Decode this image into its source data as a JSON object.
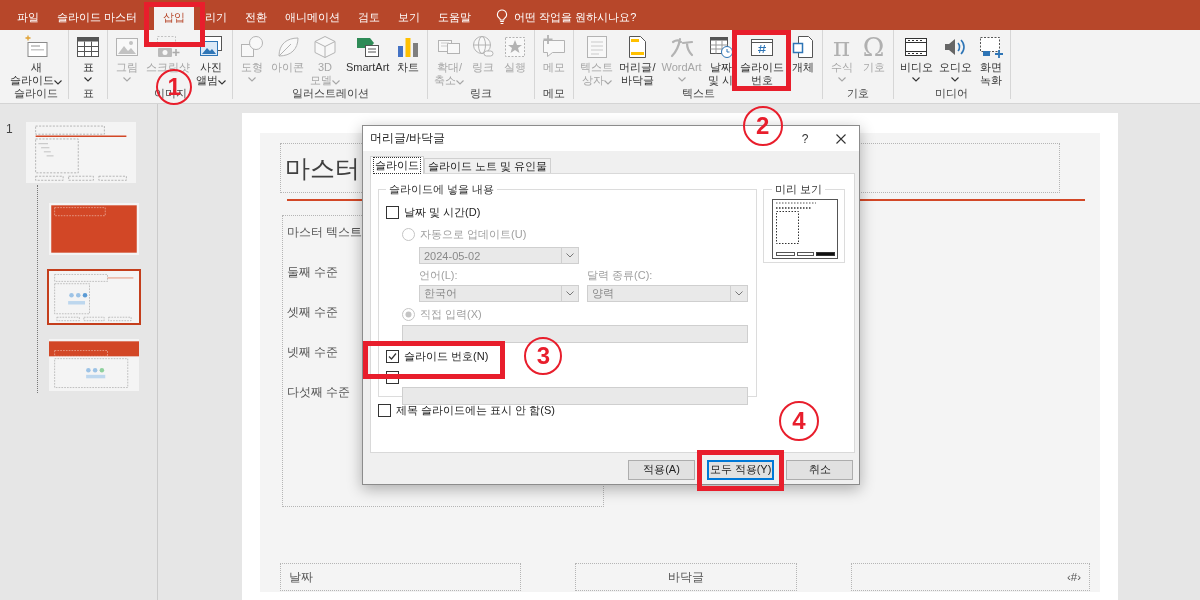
{
  "tabs": [
    {
      "label": "파일",
      "selected": false
    },
    {
      "label": "슬라이드 마스터",
      "selected": false
    },
    {
      "label": "삽입",
      "selected": true,
      "callout": "1"
    },
    {
      "label": "리기",
      "selected": false
    },
    {
      "label": "전환",
      "selected": false
    },
    {
      "label": "애니메이션",
      "selected": false
    },
    {
      "label": "검토",
      "selected": false
    },
    {
      "label": "보기",
      "selected": false
    },
    {
      "label": "도움말",
      "selected": false
    }
  ],
  "tell_me": {
    "placeholder": "어떤 작업을 원하시나요?"
  },
  "ribbon": {
    "groups": [
      {
        "label": "슬라이드",
        "buttons": [
          {
            "kind": "newslide",
            "lines": [
              "새",
              "슬라이드"
            ],
            "dropdown": true,
            "disabled": false
          }
        ]
      },
      {
        "label": "표",
        "buttons": [
          {
            "kind": "table",
            "lines": [
              "표"
            ],
            "dropdown": true,
            "disabled": false
          }
        ]
      },
      {
        "label": "이미지",
        "buttons": [
          {
            "kind": "picture",
            "lines": [
              "그림"
            ],
            "dropdown": true,
            "disabled": true
          },
          {
            "kind": "screenshot",
            "lines": [
              "스크린샷"
            ],
            "dropdown": false,
            "disabled": true
          },
          {
            "kind": "album",
            "lines": [
              "사진",
              "앨범"
            ],
            "dropdown": true,
            "disabled": false
          }
        ]
      },
      {
        "label": "일러스트레이션",
        "buttons": [
          {
            "kind": "shapes",
            "lines": [
              "도형"
            ],
            "dropdown": true,
            "disabled": true
          },
          {
            "kind": "icons",
            "lines": [
              "아이콘"
            ],
            "dropdown": false,
            "disabled": true
          },
          {
            "kind": "model",
            "lines": [
              "3D",
              "모델"
            ],
            "dropdown": true,
            "disabled": true
          },
          {
            "kind": "smartart",
            "lines": [
              "SmartArt"
            ],
            "dropdown": false,
            "disabled": false
          },
          {
            "kind": "chart",
            "lines": [
              "차트"
            ],
            "dropdown": false,
            "disabled": false
          }
        ]
      },
      {
        "label": "링크",
        "buttons": [
          {
            "kind": "zoom",
            "lines": [
              "확대/",
              "축소"
            ],
            "dropdown": true,
            "disabled": true
          },
          {
            "kind": "link",
            "lines": [
              "링크"
            ],
            "dropdown": false,
            "disabled": true
          },
          {
            "kind": "action",
            "lines": [
              "실행"
            ],
            "dropdown": false,
            "disabled": true
          }
        ]
      },
      {
        "label": "메모",
        "buttons": [
          {
            "kind": "comment",
            "lines": [
              "메모"
            ],
            "dropdown": false,
            "disabled": true
          }
        ]
      },
      {
        "label": "텍스트",
        "buttons": [
          {
            "kind": "textbox",
            "lines": [
              "텍스트",
              "상자"
            ],
            "dropdown": true,
            "disabled": true
          },
          {
            "kind": "headerfooter",
            "lines": [
              "머리글/",
              "바닥글"
            ],
            "dropdown": false,
            "disabled": false
          },
          {
            "kind": "wordart",
            "lines": [
              "WordArt"
            ],
            "dropdown": true,
            "disabled": true
          },
          {
            "kind": "datetime",
            "lines": [
              "날짜",
              "및 시"
            ],
            "dropdown": false,
            "disabled": false
          },
          {
            "kind": "slidenumber",
            "lines": [
              "슬라이드",
              "번호"
            ],
            "dropdown": false,
            "disabled": false,
            "callout": "2"
          },
          {
            "kind": "object",
            "lines": [
              "개체"
            ],
            "dropdown": false,
            "disabled": false
          }
        ]
      },
      {
        "label": "기호",
        "buttons": [
          {
            "kind": "equation",
            "glyph": "π",
            "lines": [
              "수식"
            ],
            "dropdown": true,
            "disabled": true
          },
          {
            "kind": "symbol",
            "glyph": "Ω",
            "lines": [
              "기호"
            ],
            "dropdown": false,
            "disabled": true
          }
        ]
      },
      {
        "label": "미디어",
        "buttons": [
          {
            "kind": "video",
            "lines": [
              "비디오"
            ],
            "dropdown": true,
            "disabled": false
          },
          {
            "kind": "audio",
            "lines": [
              "오디오"
            ],
            "dropdown": true,
            "disabled": false
          },
          {
            "kind": "recording",
            "lines": [
              "화면",
              "녹화"
            ],
            "dropdown": false,
            "disabled": false
          }
        ]
      }
    ]
  },
  "slide_panel": {
    "number": "1",
    "thumbnails": [
      {
        "kind": "master",
        "selected": false
      },
      {
        "kind": "title",
        "selected": false
      },
      {
        "kind": "content",
        "selected": true
      },
      {
        "kind": "section",
        "selected": false
      }
    ]
  },
  "slide": {
    "title": "마스터",
    "levels": [
      "마스터 텍스트",
      "둘째 수준",
      "셋째 수준",
      "넷째 수준",
      "다섯째 수준"
    ],
    "placeholders": [
      {
        "kind": "date",
        "text": "날짜"
      },
      {
        "kind": "footer",
        "text": "바닥글"
      },
      {
        "kind": "number",
        "text": "‹#›"
      }
    ]
  },
  "dialog": {
    "title": "머리글/바닥글",
    "help": "?",
    "tabs": [
      {
        "label": "슬라이드",
        "selected": true
      },
      {
        "label": "슬라이드 노트 및 유인물",
        "selected": false
      }
    ],
    "group": {
      "legend": "슬라이드에 넣을 내용",
      "date_time": {
        "label": "날짜 및 시간(D)",
        "checked": false
      },
      "auto_update": {
        "label": "자동으로 업데이트(U)",
        "selected": false,
        "disabled": true
      },
      "date_format": {
        "value": "2024-05-02",
        "disabled": true
      },
      "language": {
        "label": "언어(L):",
        "value": "한국어",
        "disabled": true
      },
      "calendar": {
        "label": "달력 종류(C):",
        "value": "양력",
        "disabled": true
      },
      "fixed": {
        "label": "직접 입력(X)",
        "selected": true,
        "disabled": true
      },
      "fixed_input": {
        "disabled": true
      },
      "slide_number": {
        "label": "슬라이드 번호(N)",
        "checked": true,
        "callout": "3"
      },
      "footer": {
        "checked": false
      },
      "footer_input": {
        "disabled": true
      }
    },
    "hide_on_title": {
      "label": "제목 슬라이드에는 표시 안 함(S)",
      "checked": false
    },
    "preview": {
      "legend": "미리 보기"
    },
    "buttons": [
      {
        "label": "적용(A)",
        "default": false
      },
      {
        "label": "모두 적용(Y)",
        "default": true,
        "callout": "4"
      },
      {
        "label": "취소",
        "default": false
      }
    ]
  }
}
